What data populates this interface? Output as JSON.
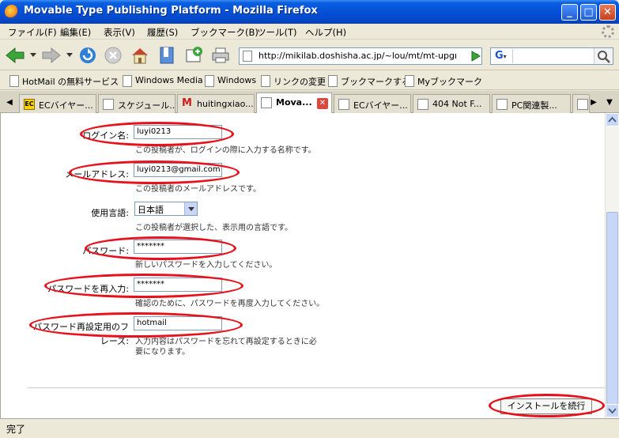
{
  "window": {
    "title": "Movable Type Publishing Platform - Mozilla Firefox"
  },
  "menu": [
    "ファイル(F)",
    "編集(E)",
    "表示(V)",
    "履歴(S)",
    "ブックマーク(B)",
    "ツール(T)",
    "ヘルプ(H)"
  ],
  "navbar": {
    "url": "http://mikilab.doshisha.ac.jp/~lou/mt/mt-upgra",
    "search_engine": "G",
    "search_value": ""
  },
  "bookmarks": [
    "HotMail の無料サービス",
    "Windows Media",
    "Windows",
    "リンクの変更",
    "ブックマークする",
    "Myブックマーク"
  ],
  "tabs": [
    {
      "label": "ECバイヤー...",
      "icon": "ec"
    },
    {
      "label": "スケジュール...",
      "icon": "page"
    },
    {
      "label": "huitingxiao...",
      "icon": "gmail"
    },
    {
      "label": "Mova...",
      "icon": "page",
      "active": true
    },
    {
      "label": "ECバイヤー...",
      "icon": "page"
    },
    {
      "label": "404 Not F...",
      "icon": "page"
    },
    {
      "label": "PC関連製...",
      "icon": "page"
    }
  ],
  "form": {
    "login_label": "ログイン名:",
    "login_value": "luyi0213",
    "login_hint": "この投稿者が、ログインの際に入力する名称です。",
    "email_label": "メールアドレス:",
    "email_value": "luyi0213@gmail.com",
    "email_hint": "この投稿者のメールアドレスです。",
    "lang_label": "使用言語:",
    "lang_value": "日本語",
    "lang_hint": "この投稿者が選択した、表示用の言語です。",
    "password_label": "パスワード:",
    "password_value": "*******",
    "password_hint": "新しいパスワードを入力してください。",
    "password2_label": "パスワードを再入力:",
    "password2_value": "*******",
    "password2_hint": "確認のために、パスワードを再度入力してください。",
    "hint_label_1": "パスワード再設定用のフ",
    "hint_label_2": "レーズ:",
    "hint_value": "hotmail",
    "hint_hint_1": "入力内容はパスワードを忘れて再設定するときに必",
    "hint_hint_2": "要になります。",
    "install_label": "インストールを続行"
  },
  "status": {
    "text": "完了"
  },
  "colors": {
    "annotation": "#e8101a"
  }
}
